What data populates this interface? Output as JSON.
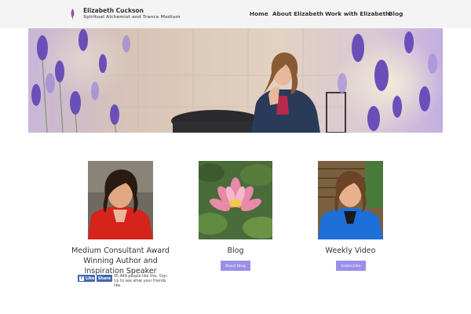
{
  "header": {
    "site_name": "Elizabeth Cuckson",
    "tagline": "Spiritual Alchemist and Trance Medium",
    "logo_icon": "feather-quill-icon",
    "nav": [
      "Home",
      "About Elizabeth",
      "Work with Elizabeth",
      "Blog"
    ]
  },
  "hero": {
    "image": "banner-woman-seated-among-lavender",
    "accent_color": "#8a72c8"
  },
  "cards": [
    {
      "title": "Medium Consultant Award Winning Author and Inspiration Speaker",
      "image": "portrait-woman-red-jacket"
    },
    {
      "title": "Blog",
      "image": "pink-lotus-flower",
      "button": "Read Blog"
    },
    {
      "title": "Weekly Video",
      "image": "portrait-woman-blue-jacket",
      "button": "Subscribe"
    }
  ],
  "facebook": {
    "like_label": "Like",
    "share_label": "Share",
    "count_text": "45,449 people like this.",
    "signup_link": "Sign Up",
    "signup_rest": " to see what your friends like."
  },
  "colors": {
    "header_bg": "#f4f4f4",
    "button_bg": "#9b8fe8",
    "facebook_blue": "#4267b2"
  }
}
